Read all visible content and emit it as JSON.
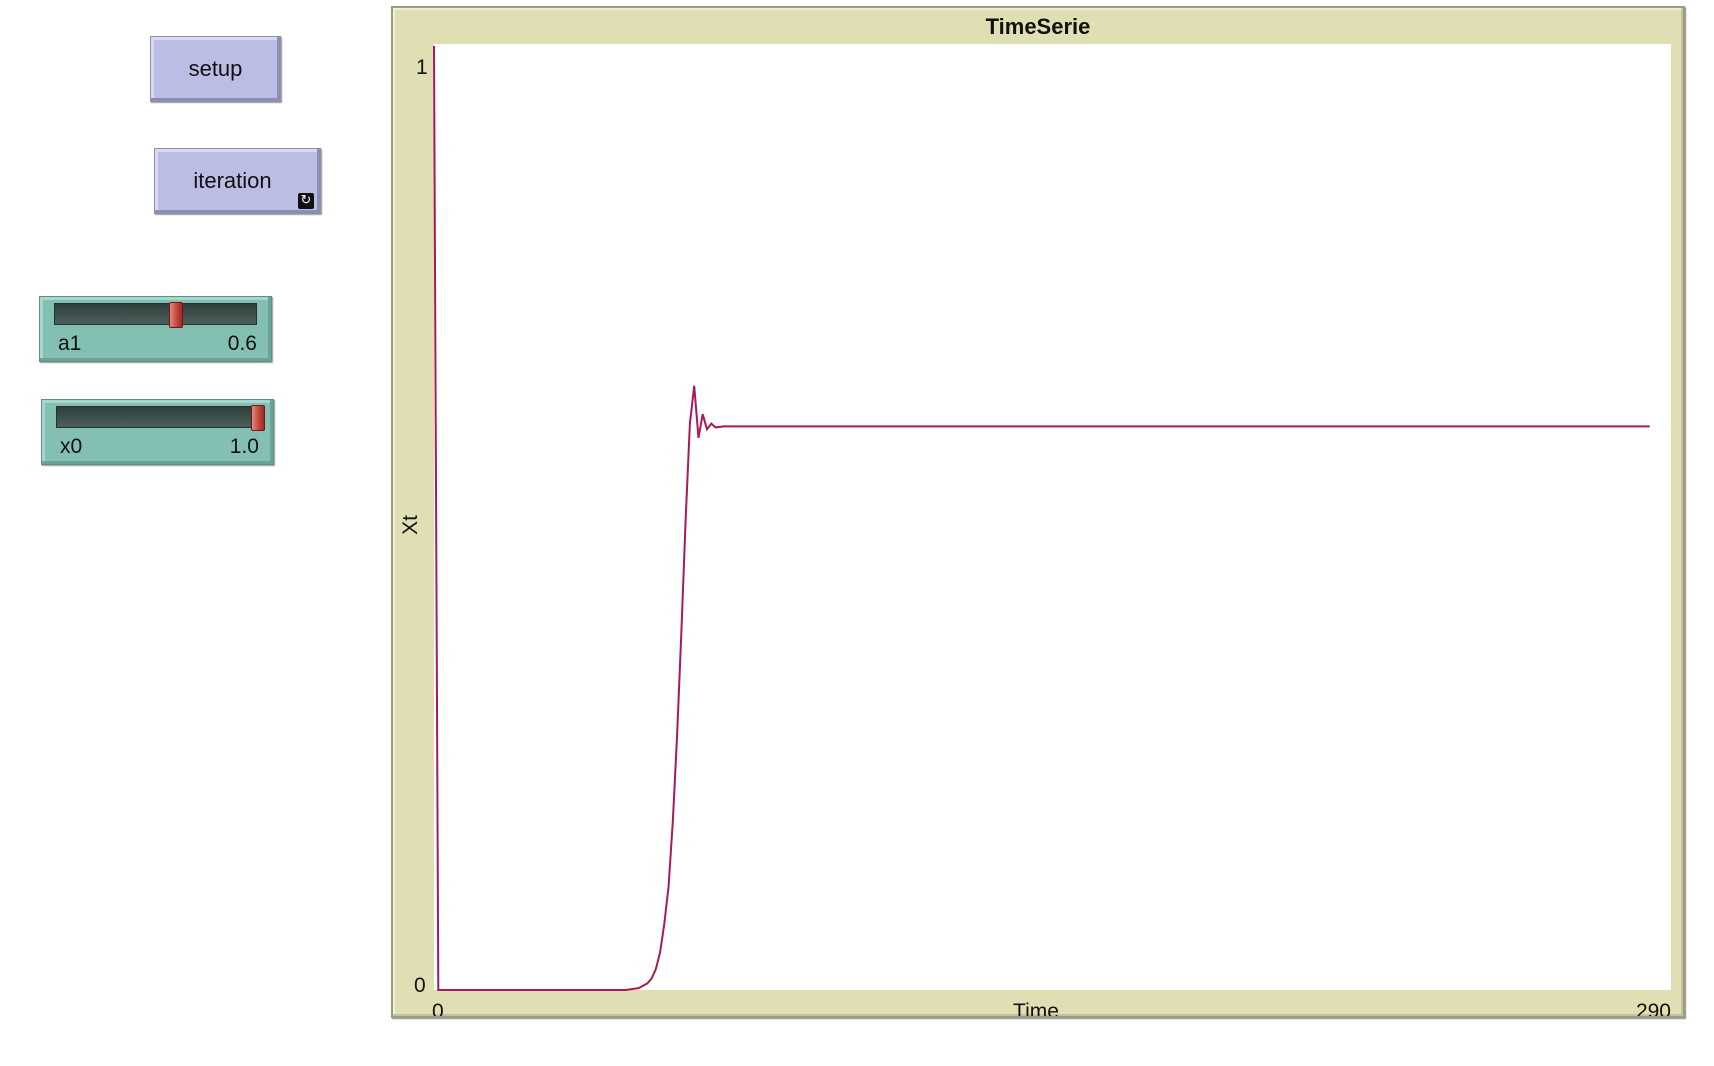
{
  "controls": {
    "setup_button": {
      "label": "setup"
    },
    "iteration_button": {
      "label": "iteration",
      "forever_icon": "forever-loop-icon"
    },
    "sliders": [
      {
        "id": "a1",
        "name": "a1",
        "value_text": "0.6",
        "value": 0.6,
        "fraction": 0.6
      },
      {
        "id": "x0",
        "name": "x0",
        "value_text": "1.0",
        "value": 1.0,
        "fraction": 1.0
      }
    ]
  },
  "colors": {
    "button": "#bcbde5",
    "slider": "#84bfb4",
    "slider_thumb": "#c2433b",
    "plot_frame": "#e0dfb4",
    "series": "#a8185c"
  },
  "chart_data": {
    "type": "line",
    "title": "TimeSerie",
    "xlabel": "Time",
    "ylabel": "Xt",
    "xlim": [
      0,
      290
    ],
    "ylim": [
      0,
      1
    ],
    "x_tick_labels": [
      "0",
      "290"
    ],
    "y_tick_labels": [
      "0",
      "1"
    ],
    "grid": false,
    "series": [
      {
        "color": "#a8185c",
        "x": [
          0,
          1,
          2,
          10,
          20,
          30,
          40,
          45,
          48,
          50,
          51,
          52,
          53,
          54,
          55,
          56,
          57,
          58,
          59,
          60,
          61,
          62,
          63,
          64,
          65,
          66,
          68,
          70,
          100,
          150,
          200,
          250,
          285
        ],
        "y": [
          1.0,
          0.0,
          0.0,
          0.0,
          0.0,
          0.0,
          0.0,
          0.0,
          0.002,
          0.007,
          0.012,
          0.022,
          0.04,
          0.07,
          0.11,
          0.18,
          0.27,
          0.38,
          0.5,
          0.6,
          0.64,
          0.585,
          0.61,
          0.594,
          0.6,
          0.596,
          0.597,
          0.597,
          0.597,
          0.597,
          0.597,
          0.597,
          0.597
        ]
      }
    ]
  }
}
